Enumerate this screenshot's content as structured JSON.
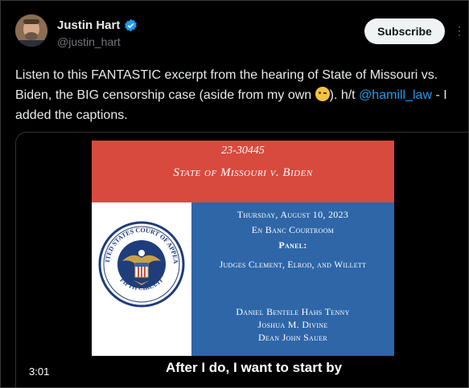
{
  "author": {
    "display_name": "Justin Hart",
    "handle": "@justin_hart",
    "verified": true
  },
  "actions": {
    "subscribe_label": "Subscribe",
    "more_icon": "more-icon"
  },
  "tweet": {
    "text_part1": "Listen to this FANTASTIC excerpt from the hearing of State of Missouri vs. Biden, the BIG censorship case (aside from my own ",
    "emoji": "winking-face",
    "text_part2": "). h/t ",
    "mention": "@hamill_law",
    "text_part3": " - I added the captions."
  },
  "video": {
    "duration": "3:01",
    "caption": "After I do, I want to start by",
    "slide": {
      "case_number": "23-30445",
      "case_title": "State of Missouri v. Biden",
      "date": "Thursday, August 10, 2023",
      "room": "En Banc Courtroom",
      "panel_label": "Panel:",
      "judges": "Judges Clement, Elrod, and Willett",
      "counsel": [
        "Daniel Bentele Hahs Tenny",
        "Joshua M. Divine",
        "Dean John Sauer"
      ],
      "seal_text_top": "UNITED STATES COURT OF APPEALS",
      "seal_text_bottom": "FIFTH CIRCUIT"
    }
  },
  "colors": {
    "background": "#000000",
    "text": "#e7e9ea",
    "muted": "#71767b",
    "link": "#1d9bf0",
    "verified": "#1d9bf0",
    "slide_red": "#d84a3e",
    "slide_blue": "#2e66a8"
  }
}
